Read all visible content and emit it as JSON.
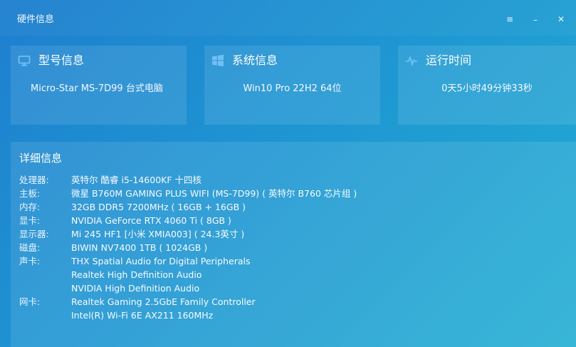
{
  "window": {
    "title": "硬件信息",
    "controls": {
      "menu": "≡",
      "minimize": "–",
      "close": "✕"
    }
  },
  "cards": {
    "model": {
      "icon": "monitor-icon",
      "title": "型号信息",
      "value": "Micro-Star  MS-7D99 台式电脑"
    },
    "system": {
      "icon": "windows-logo-icon",
      "title": "系统信息",
      "value": "Win10 Pro 22H2 64位"
    },
    "uptime": {
      "icon": "pulse-icon",
      "title": "运行时间",
      "value": "0天5小时49分钟33秒"
    }
  },
  "details": {
    "title": "详细信息",
    "rows": [
      {
        "label": "处理器:",
        "value": "英特尔 酷睿 i5-14600KF 十四核"
      },
      {
        "label": "主板:",
        "value": "微星 B760M GAMING PLUS WIFI (MS-7D99) ( 英特尔 B760 芯片组 )"
      },
      {
        "label": "内存:",
        "value": "32GB DDR5 7200MHz ( 16GB + 16GB )"
      },
      {
        "label": "显卡:",
        "value": "NVIDIA GeForce RTX 4060 Ti ( 8GB )"
      },
      {
        "label": "显示器:",
        "value": "Mi 245 HF1 [小米 XMIA003] ( 24.3英寸 )"
      },
      {
        "label": "磁盘:",
        "value": "BIWIN NV7400 1TB ( 1024GB )"
      },
      {
        "label": "声卡:",
        "value": "THX Spatial Audio for Digital Peripherals"
      },
      {
        "label": "",
        "value": "Realtek High Definition Audio"
      },
      {
        "label": "",
        "value": "NVIDIA High Definition Audio"
      },
      {
        "label": "网卡:",
        "value": "Realtek Gaming 2.5GbE Family Controller"
      },
      {
        "label": "",
        "value": "Intel(R) Wi-Fi 6E AX211 160MHz"
      }
    ]
  }
}
